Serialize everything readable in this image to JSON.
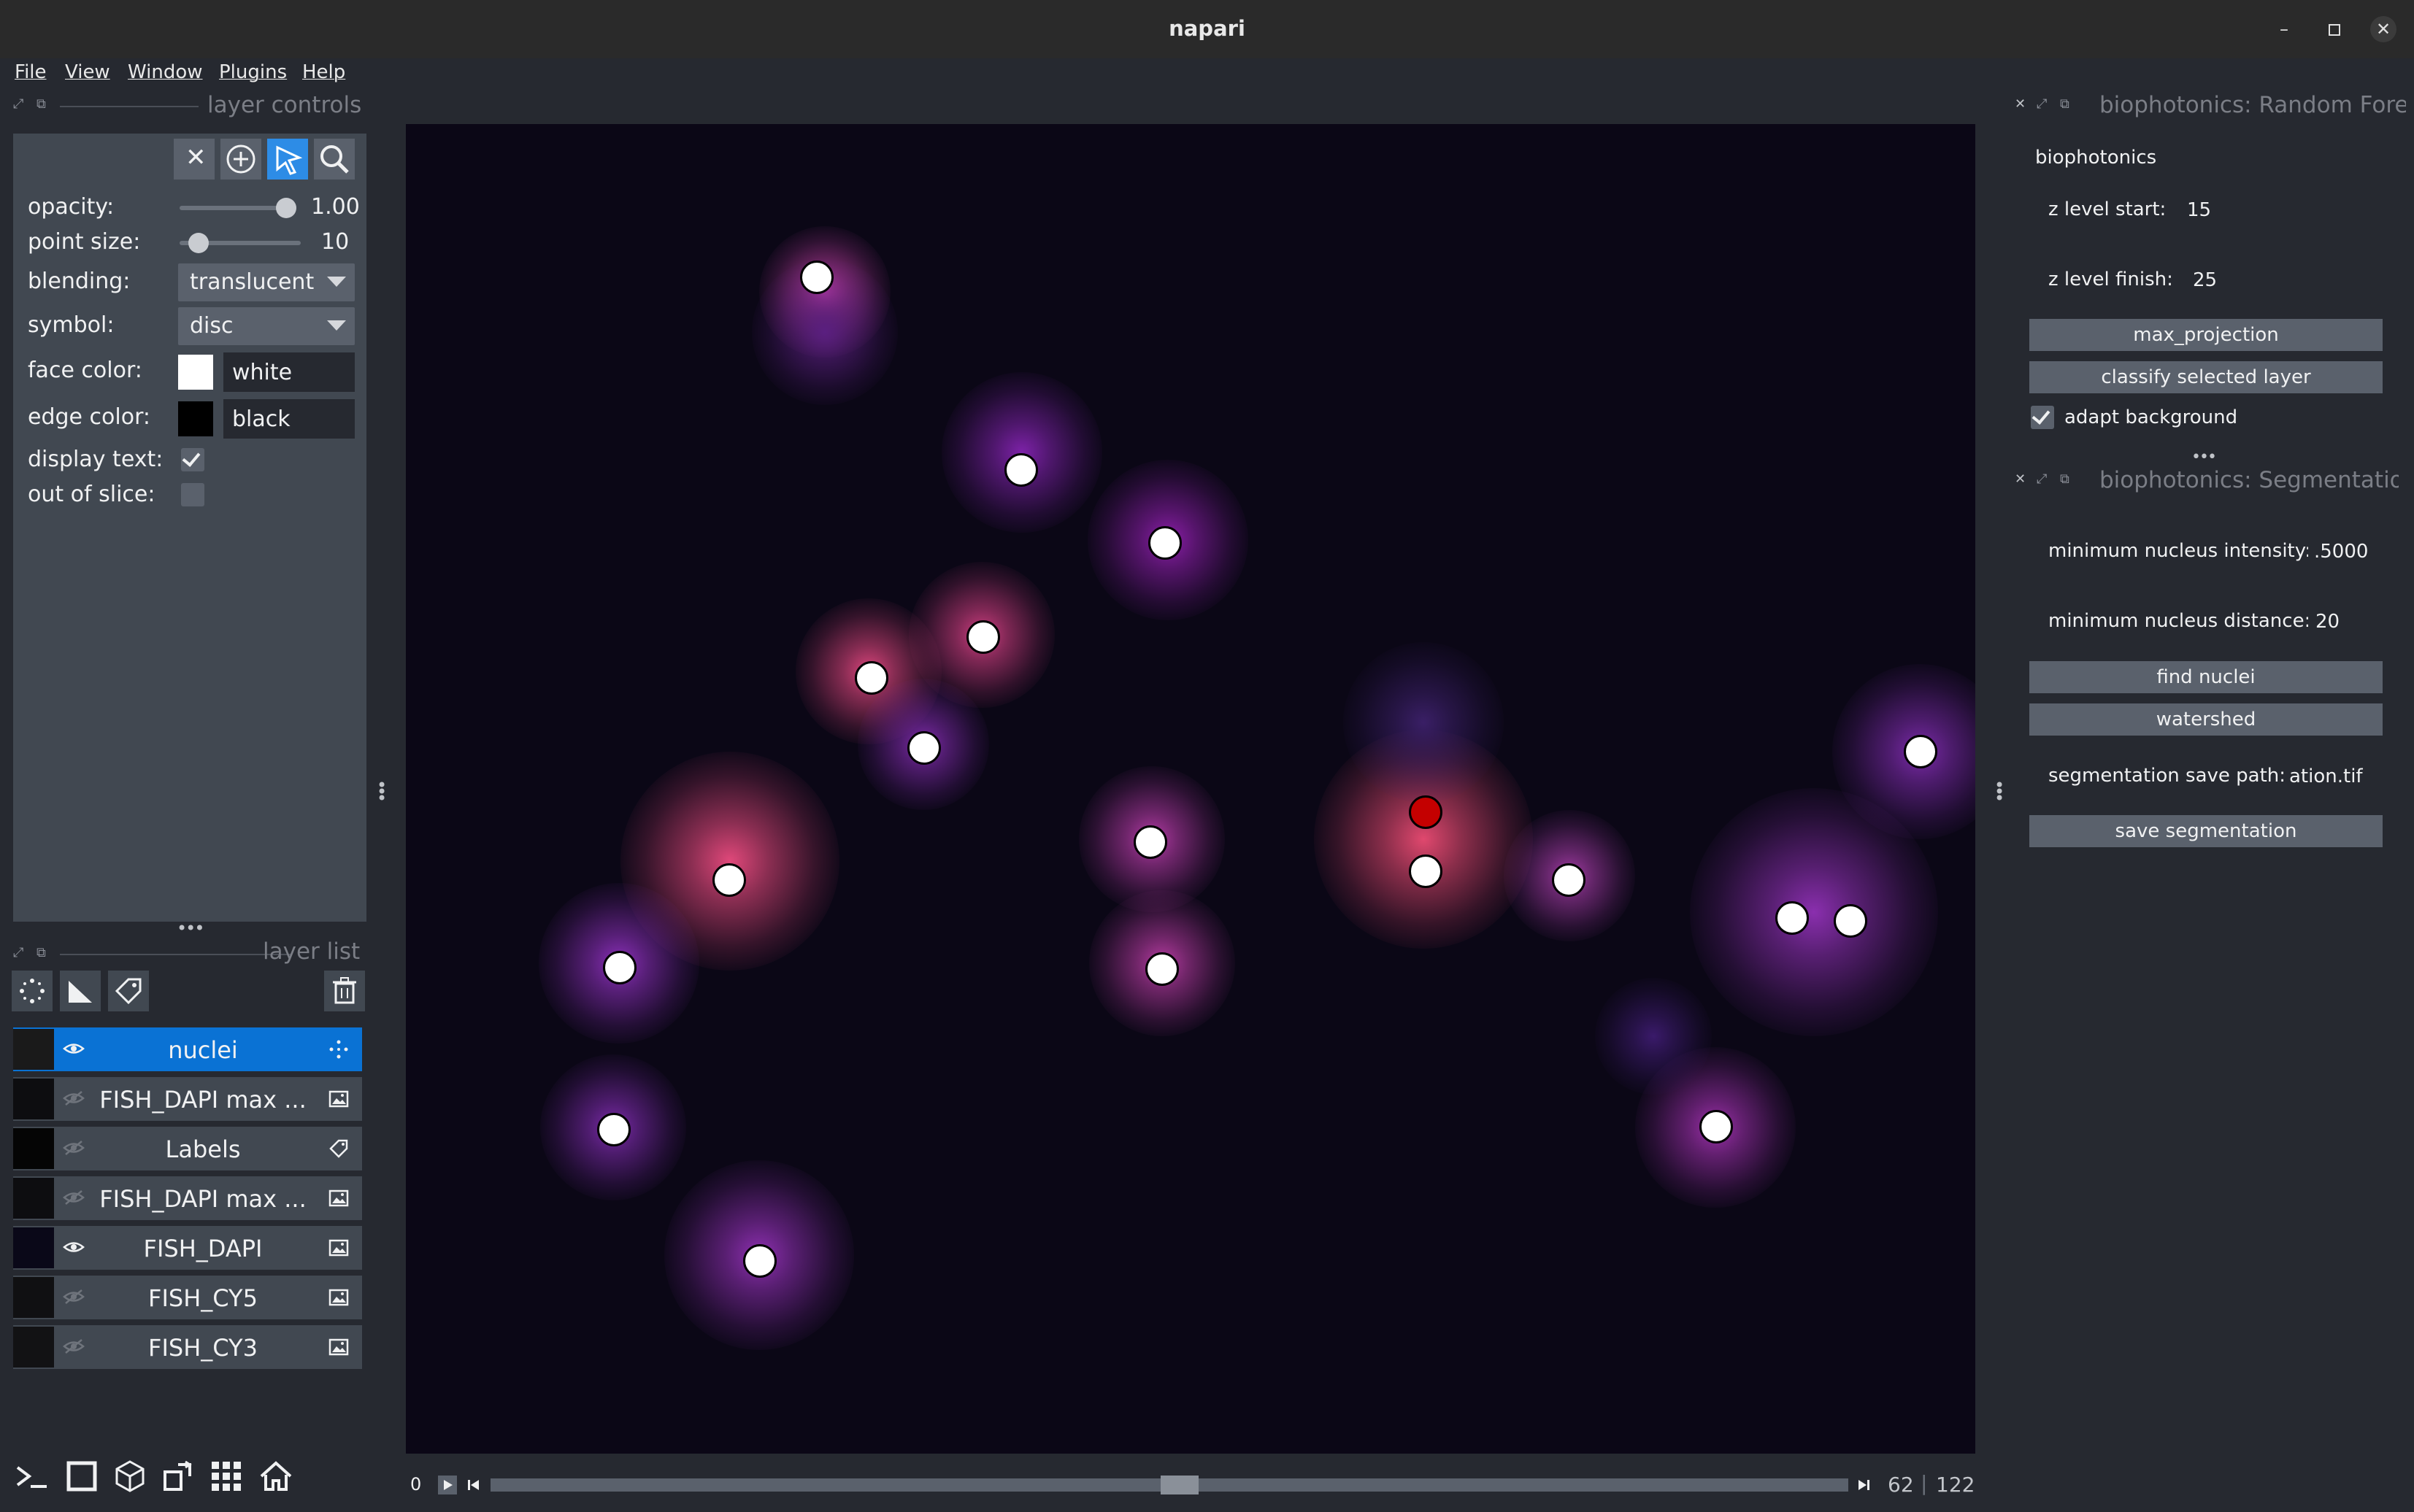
{
  "window": {
    "title": "napari"
  },
  "menu": [
    "File",
    "View",
    "Window",
    "Plugins",
    "Help"
  ],
  "layer_controls": {
    "title": "layer controls",
    "opacity": {
      "label": "opacity:",
      "value": "1.00"
    },
    "point_size": {
      "label": "point size:",
      "value": "10"
    },
    "blending": {
      "label": "blending:",
      "value": "translucent"
    },
    "symbol": {
      "label": "symbol:",
      "value": "disc"
    },
    "face_color": {
      "label": "face color:",
      "value": "white",
      "swatch": "#ffffff"
    },
    "edge_color": {
      "label": "edge color:",
      "value": "black",
      "swatch": "#000000"
    },
    "display_text": {
      "label": "display text:",
      "checked": true
    },
    "out_of_slice": {
      "label": "out of slice:",
      "checked": false
    },
    "tools": [
      "delete-selected-icon",
      "add-points-icon",
      "select-points-icon",
      "pan-zoom-icon"
    ]
  },
  "layer_list": {
    "title": "layer list",
    "layers": [
      {
        "name": "nuclei",
        "visible": true,
        "type": "points",
        "selected": true
      },
      {
        "name": "FISH_DAPI max ...",
        "visible": false,
        "type": "image"
      },
      {
        "name": "Labels",
        "visible": false,
        "type": "labels"
      },
      {
        "name": "FISH_DAPI max ...",
        "visible": false,
        "type": "image"
      },
      {
        "name": "FISH_DAPI",
        "visible": true,
        "type": "image"
      },
      {
        "name": "FISH_CY5",
        "visible": false,
        "type": "image"
      },
      {
        "name": "FISH_CY3",
        "visible": false,
        "type": "image"
      }
    ]
  },
  "dims_slider": {
    "start": "0",
    "current": "62",
    "total": "122",
    "position_fraction": 0.508
  },
  "right_dock": {
    "random_forest": {
      "title": "biophotonics: Random Fore",
      "group": "biophotonics",
      "z_start_label": "z level start:",
      "z_start_value": "15",
      "z_finish_label": "z level finish:",
      "z_finish_value": "25",
      "btn_max": "max_projection",
      "btn_classify": "classify selected layer",
      "adapt_label": "adapt background",
      "adapt_checked": true
    },
    "segmentation": {
      "title": "biophotonics: Segmentatio",
      "min_intensity_label": "minimum nucleus intensity:",
      "min_intensity_value": ".5000",
      "min_distance_label": "minimum nucleus distance:",
      "min_distance_value": "20",
      "btn_find": "find nuclei",
      "btn_watershed": "watershed",
      "save_path_label": "segmentation save path:",
      "save_path_value": "ation.tif",
      "btn_save": "save segmentation"
    }
  },
  "colors": {
    "accent": "#0a72d4",
    "panel": "#414851",
    "background": "#262930",
    "canvas": "#0b0716",
    "selected_point": "#c40000"
  }
}
